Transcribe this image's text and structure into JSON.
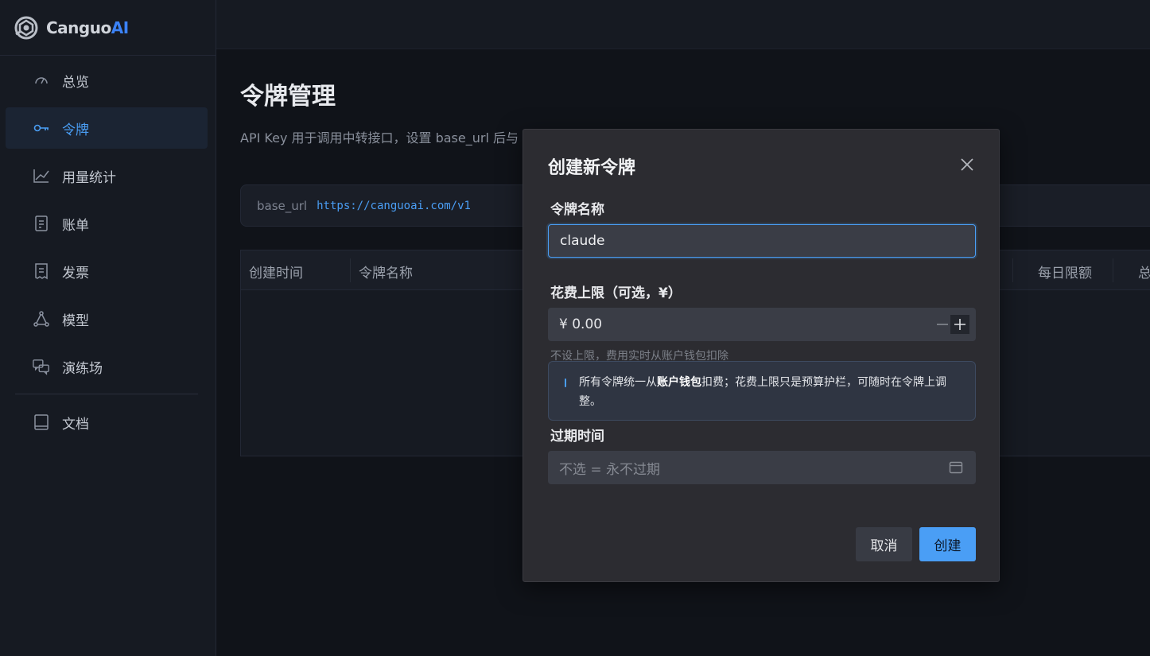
{
  "brand": {
    "name_main": "Canguo",
    "name_accent": "AI"
  },
  "sidebar": {
    "items": [
      {
        "label": "总览",
        "icon": "gauge-icon",
        "active": false
      },
      {
        "label": "令牌",
        "icon": "key-icon",
        "active": true
      },
      {
        "label": "用量统计",
        "icon": "chart-line-icon",
        "active": false
      },
      {
        "label": "账单",
        "icon": "document-icon",
        "active": false
      },
      {
        "label": "发票",
        "icon": "receipt-icon",
        "active": false
      },
      {
        "label": "模型",
        "icon": "model-graph-icon",
        "active": false
      },
      {
        "label": "演练场",
        "icon": "chat-bubbles-icon",
        "active": false
      }
    ],
    "bottom_items": [
      {
        "label": "文档",
        "icon": "book-icon"
      }
    ]
  },
  "main": {
    "title": "令牌管理",
    "description": "API Key 用于调用中转接口，设置 base_url 后与",
    "base_url": {
      "label": "base_url",
      "value": "https://canguoai.com/v1"
    },
    "table": {
      "headers": [
        "创建时间",
        "令牌名称",
        "每日限额",
        "总"
      ]
    }
  },
  "modal": {
    "title": "创建新令牌",
    "name_label": "令牌名称",
    "name_value": "claude",
    "limit_label": "花费上限（可选，¥）",
    "limit_value": "¥ 0.00",
    "limit_hint": "不设上限，费用实时从账户钱包扣除",
    "notice": {
      "part1": "所有令牌统一从",
      "bold": "账户钱包",
      "part2": "扣费；花费上限只是预算护栏，可随时在令牌上调整。"
    },
    "expire_label": "过期时间",
    "expire_placeholder": "不选 = 永不过期",
    "cancel_label": "取消",
    "create_label": "创建"
  },
  "colors": {
    "accent": "#4a9ef5",
    "background": "#101319",
    "sidebar": "#161a22",
    "modal": "#2c2c31"
  }
}
